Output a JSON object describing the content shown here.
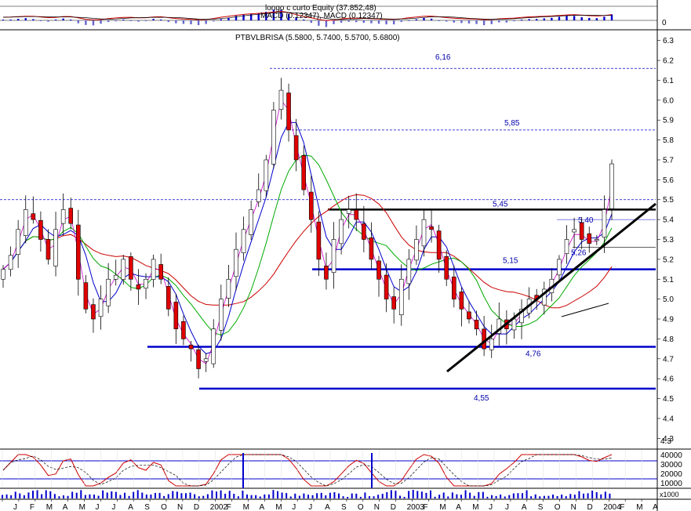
{
  "macd_panel": {
    "title": "longo c curto Equity (37.852,48)",
    "subtitle": "MACD (0.12347), MACD (0.12347)",
    "ytick": "0"
  },
  "price_panel": {
    "title": "PTBVLBRISA (5.5800, 5.7400, 5.5700, 5.6800)"
  },
  "volume_panel": {
    "unit_label": "x1000"
  },
  "colors": {
    "candle_up": "#ffffff",
    "candle_down": "#e00000",
    "ma_short": "#0000cc",
    "ma_mid": "#00aa00",
    "ma_long": "#cc0000",
    "support_lines": "#0000cc",
    "resistance_line": "#000000",
    "stochastic": "#cc0000",
    "macd_line": "#cc0000"
  },
  "chart_data": [
    {
      "type": "line",
      "panel": "price",
      "title": "PTBVLBRISA (5.5800, 5.7400, 5.5700, 5.6800)",
      "subtitle": "candlestick price chart with moving averages",
      "y_ticks": [
        4.3,
        4.4,
        4.5,
        4.6,
        4.7,
        4.8,
        4.9,
        5.0,
        5.1,
        5.2,
        5.3,
        5.4,
        5.5,
        5.6,
        5.7,
        5.8,
        5.9,
        6.0,
        6.1,
        6.2,
        6.3
      ],
      "ylim": [
        4.25,
        6.35
      ],
      "x_labels": [
        "J",
        "F",
        "M",
        "A",
        "M",
        "J",
        "J",
        "A",
        "S",
        "O",
        "N",
        "D",
        "2002",
        "F",
        "M",
        "A",
        "M",
        "J",
        "J",
        "A",
        "S",
        "O",
        "N",
        "D",
        "2003",
        "F",
        "M",
        "A",
        "M",
        "J",
        "J",
        "A",
        "S",
        "O",
        "N",
        "D",
        "2004",
        "F",
        "M",
        "A"
      ],
      "horizontal_levels": [
        {
          "label": "6,16",
          "value": 6.16,
          "style": "dashed"
        },
        {
          "label": "5,85",
          "value": 5.85,
          "style": "dashed"
        },
        {
          "label": "5,45",
          "value": 5.45,
          "style": "solid-black"
        },
        {
          "label": "5,40",
          "value": 5.4,
          "style": "thin"
        },
        {
          "label": "5,26",
          "value": 5.26,
          "style": "thin"
        },
        {
          "label": "5,15",
          "value": 5.15,
          "style": "solid-blue"
        },
        {
          "label": "4,76",
          "value": 4.76,
          "style": "solid-blue"
        },
        {
          "label": "4,55",
          "value": 4.55,
          "style": "solid-blue"
        }
      ],
      "dashed_level_5_50": 5.5,
      "series": [
        {
          "name": "close",
          "values": [
            5.15,
            5.22,
            5.35,
            5.45,
            5.4,
            5.3,
            5.2,
            5.35,
            5.45,
            5.38,
            5.1,
            4.95,
            4.9,
            5.0,
            5.1,
            5.12,
            5.2,
            5.1,
            5.05,
            5.1,
            5.2,
            5.1,
            4.95,
            4.85,
            4.8,
            4.75,
            4.65,
            4.7,
            4.85,
            5.0,
            5.1,
            5.25,
            5.35,
            5.45,
            5.55,
            5.7,
            5.95,
            6.05,
            5.85,
            5.7,
            5.55,
            5.4,
            5.2,
            5.1,
            5.3,
            5.4,
            5.45,
            5.4,
            5.3,
            5.2,
            5.1,
            5.0,
            4.95,
            5.1,
            5.2,
            5.3,
            5.4,
            5.35,
            5.2,
            5.1,
            5.0,
            4.95,
            4.9,
            4.85,
            4.75,
            4.8,
            4.9,
            4.85,
            4.9,
            4.95,
            5.0,
            5.0,
            5.05,
            5.1,
            5.2,
            5.3,
            5.35,
            5.3,
            5.28,
            5.3,
            5.45,
            5.68
          ]
        }
      ]
    },
    {
      "type": "line",
      "panel": "stochastic",
      "y_ticks": [
        "4.3",
        "40000",
        "30000",
        "20000",
        "10000"
      ]
    },
    {
      "type": "bar",
      "panel": "volume",
      "unit": "x1000"
    }
  ]
}
